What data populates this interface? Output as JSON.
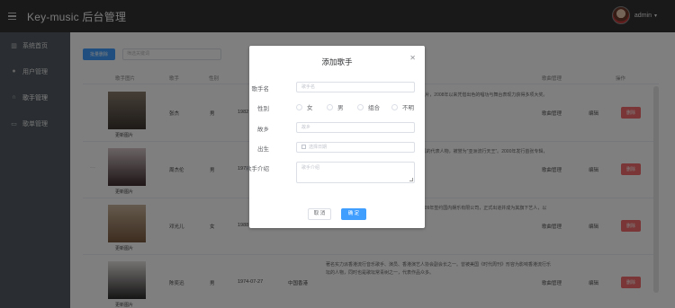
{
  "header": {
    "title": "Key-music 后台管理",
    "username": "admin"
  },
  "sidebar": {
    "items": [
      {
        "label": "系统首页",
        "icon": "bar-chart-icon"
      },
      {
        "label": "用户管理",
        "icon": "user-icon"
      },
      {
        "label": "歌手管理",
        "icon": "headphones-icon"
      },
      {
        "label": "歌单管理",
        "icon": "document-icon"
      }
    ]
  },
  "toolbar": {
    "add_label": "批量删除",
    "search_placeholder": "筛选关键词"
  },
  "table": {
    "headers": [
      "歌手图片",
      "歌手",
      "性别",
      "生日",
      "地区",
      "简介",
      "歌曲管理",
      "操作"
    ],
    "rows": [
      {
        "update": "更新图片",
        "name": "张杰",
        "sex": "男",
        "birth": "1982",
        "intro": "...极人气天王。2004年出道至今，已发行十余张唱片，2008年以来凭借出色的唱功与舞台表现力获得多项大奖。2013年以来专辑持续热销。",
        "songs": "歌曲管理",
        "edit": "编辑",
        "delete": "删除"
      },
      {
        "update": "更新图片",
        "name": "周杰伦",
        "sex": "男",
        "birth": "1979",
        "intro": "...华语乐坛天王，MV及电影导演，者中也有中国风的代表人物，被誉为\"亚洲流行天王\"。2000年发行首张专辑，2002年入选美国CNN亚洲25位最具影响力人物。",
        "songs": "歌曲管理",
        "edit": "编辑",
        "delete": "删除"
      },
      {
        "update": "更新图片",
        "name": "邓光儿",
        "sex": "女",
        "birth": "1988",
        "intro": "...内地女歌手、演员、主持人、女子组合成员。2009年签约国内娱乐有限公司，正式出道并成为其旗下艺人，以独特清澈的嗓音受到大众关注。",
        "songs": "歌曲管理",
        "edit": "编辑",
        "delete": "删除"
      },
      {
        "update": "更新图片",
        "name": "陈奕迅",
        "sex": "男",
        "birth": "1974-07-27",
        "region": "中国香港",
        "intro": "著名实力派香港流行音乐歌手、演员、香港演艺人协会副会长之一。曾被美国《时代周刊》形容为影响香港流行乐坛的人物，同时也是歌坛常青树之一，代表作品众多。",
        "songs": "歌曲管理",
        "edit": "编辑",
        "delete": "删除"
      }
    ]
  },
  "dialog": {
    "title": "添加歌手",
    "labels": {
      "name": "歌手名",
      "sex": "性别",
      "location": "故乡",
      "birth": "出生",
      "intro": "歌手介绍"
    },
    "placeholders": {
      "name": "歌手名",
      "location": "故乡",
      "birth": "选择日期",
      "intro": "歌手介绍"
    },
    "sex_options": [
      "女",
      "男",
      "组合",
      "不明"
    ],
    "cancel_label": "取 消",
    "ok_label": "确 定"
  }
}
